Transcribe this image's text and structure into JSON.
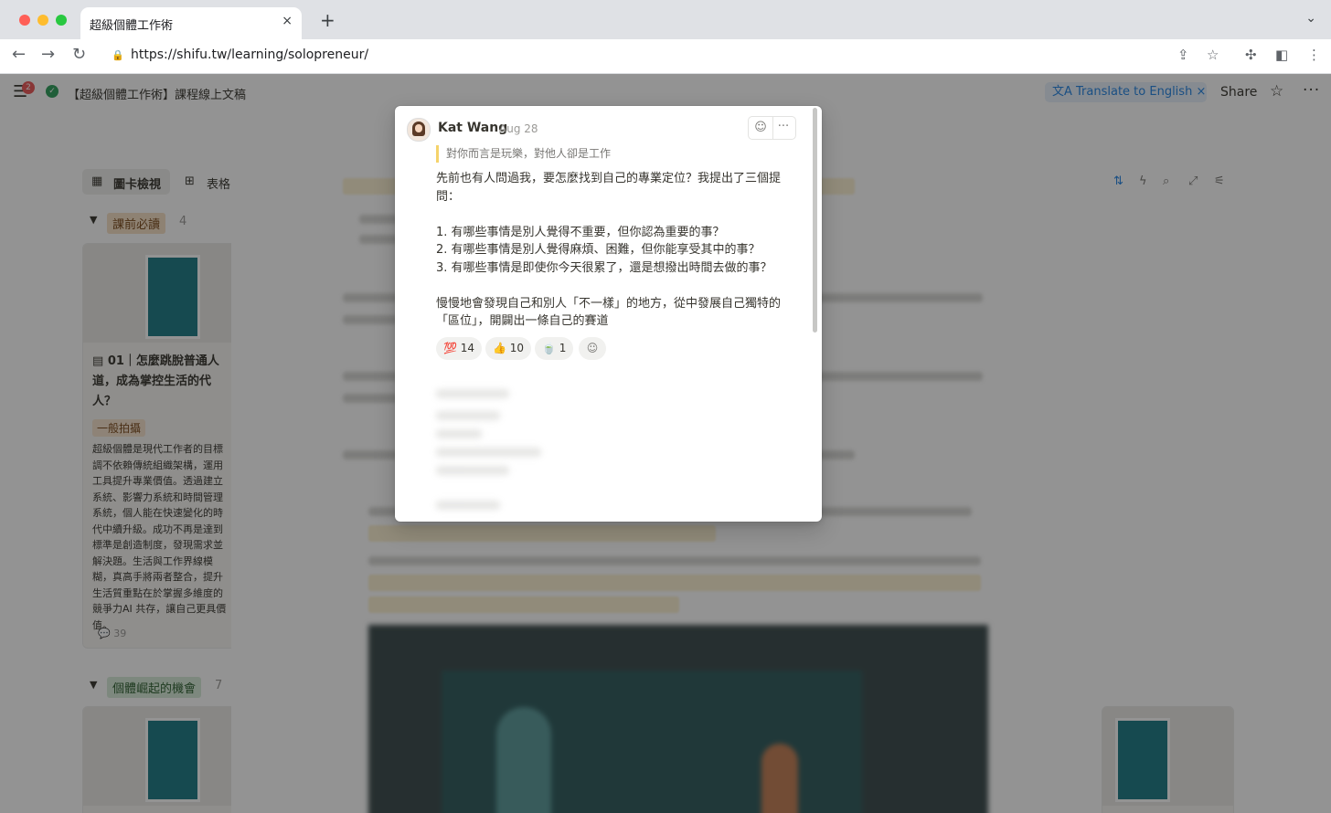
{
  "browser": {
    "tab_title": "超級個體工作術",
    "tab_close": "×",
    "new_tab": "+",
    "tab_menu": "⌄",
    "url": "https://shifu.tw/learning/solopreneur/",
    "nav": {
      "back": "←",
      "forward": "→",
      "reload": "↻"
    },
    "icons": {
      "share": "⇪",
      "bookmark": "☆",
      "extensions": "✣",
      "sidebar": "◧",
      "menu": "⋮"
    }
  },
  "notion": {
    "menu_badge": "2",
    "page_title": "【超級個體工作術】課程線上文稿",
    "translate_label": "文A Translate to English ×",
    "share_label": "Share",
    "views": [
      "圖卡檢視",
      "表格"
    ],
    "groups": [
      {
        "label": "課前必讀",
        "count": "4"
      },
      {
        "label": "個體崛起的機會",
        "count": "7"
      }
    ],
    "card": {
      "title": "01｜怎麼跳脫普通人道，成為掌控生活的代人？",
      "tag": "一般拍攝",
      "body": "超級個體是現代工作者的目標調不依賴傳統組織架構，運用工具提升專業價值。透過建立系統、影響力系統和時間管理系統，個人能在快速變化的時代中續升級。成功不再是達到標準是創造制度，發現需求並解決題。生活與工作界線模糊，真高手將兩者整合，提升生活質重點在於掌握多維度的競爭力AI 共存，讓自己更具價值。",
      "comments": "39"
    }
  },
  "comment": {
    "author": "Kat Wang",
    "date": "Aug 28",
    "quote": "對你而言是玩樂，對他人卻是工作",
    "body": "先前也有人問過我，要怎麼找到自己的專業定位？我提出了三個提問：\n\n1. 有哪些事情是別人覺得不重要，但你認為重要的事？\n2. 有哪些事情是別人覺得麻煩、困難，但你能享受其中的事？\n3. 有哪些事情是即使你今天很累了，還是想撥出時間去做的事？\n\n慢慢地會發現自己和別人「不一樣」的地方，從中發展自己獨特的「區位」，開闢出一條自己的賽道",
    "reactions": [
      {
        "emoji": "💯",
        "count": "14"
      },
      {
        "emoji": "👍",
        "count": "10"
      },
      {
        "emoji": "🍵",
        "count": "1"
      }
    ],
    "more_label": "···"
  }
}
